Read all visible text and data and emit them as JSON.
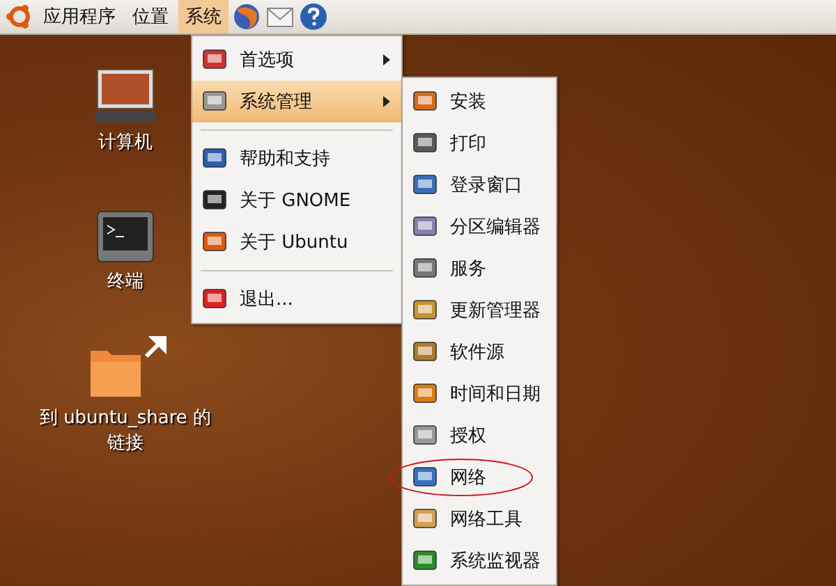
{
  "panel": {
    "menus": [
      {
        "label": "应用程序",
        "selected": false
      },
      {
        "label": "位置",
        "selected": false
      },
      {
        "label": "系统",
        "selected": true
      }
    ]
  },
  "desktop_icons": [
    {
      "label": "计算机"
    },
    {
      "label": "终端"
    },
    {
      "label": "到 ubuntu_share 的链接"
    }
  ],
  "system_menu": {
    "items": [
      {
        "kind": "item",
        "label": "首选项",
        "submenu": true,
        "selected": false
      },
      {
        "kind": "item",
        "label": "系统管理",
        "submenu": true,
        "selected": true
      },
      {
        "kind": "separator"
      },
      {
        "kind": "item",
        "label": "帮助和支持",
        "submenu": false,
        "selected": false
      },
      {
        "kind": "item",
        "label": "关于 GNOME",
        "submenu": false,
        "selected": false
      },
      {
        "kind": "item",
        "label": "关于 Ubuntu",
        "submenu": false,
        "selected": false
      },
      {
        "kind": "separator"
      },
      {
        "kind": "item",
        "label": "退出...",
        "submenu": false,
        "selected": false
      }
    ]
  },
  "admin_menu": {
    "items": [
      {
        "label": "安装",
        "circled": false
      },
      {
        "label": "打印",
        "circled": false
      },
      {
        "label": "登录窗口",
        "circled": false
      },
      {
        "label": "分区编辑器",
        "circled": false
      },
      {
        "label": "服务",
        "circled": false
      },
      {
        "label": "更新管理器",
        "circled": false
      },
      {
        "label": "软件源",
        "circled": false
      },
      {
        "label": "时间和日期",
        "circled": false
      },
      {
        "label": "授权",
        "circled": false
      },
      {
        "label": "网络",
        "circled": true
      },
      {
        "label": "网络工具",
        "circled": false
      },
      {
        "label": "系统监视器",
        "circled": false
      }
    ]
  }
}
